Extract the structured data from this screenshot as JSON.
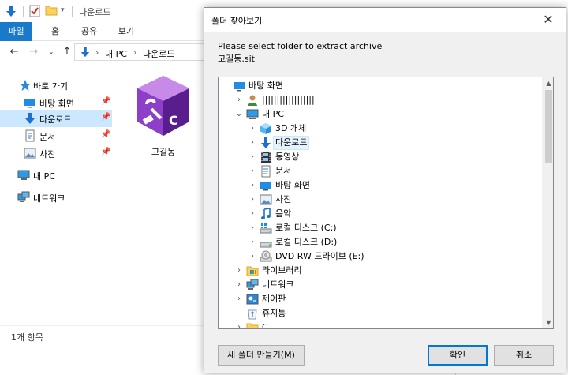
{
  "explorer": {
    "window_title": "다운로드",
    "ribbon_tabs": [
      "파일",
      "홈",
      "공유",
      "보기"
    ],
    "address": {
      "segments": [
        "내 PC",
        "다운로드"
      ],
      "separator": "›"
    },
    "nav": {
      "quick_access": "바로 가기",
      "items": [
        {
          "label": "바탕 화면",
          "icon": "desktop-icon",
          "pinned": true
        },
        {
          "label": "다운로드",
          "icon": "download-arrow-icon",
          "pinned": true,
          "selected": true
        },
        {
          "label": "문서",
          "icon": "document-icon",
          "pinned": true
        },
        {
          "label": "사진",
          "icon": "picture-icon",
          "pinned": true
        }
      ],
      "this_pc": "내 PC",
      "network": "네트워크"
    },
    "file": {
      "name": "고길동",
      "icon": "archive-box-icon"
    },
    "status": "1개 항목"
  },
  "dialog": {
    "title": "폴더 찾아보기",
    "close_glyph": "✕",
    "prompt": "Please select folder to extract archive",
    "filename": "고길동.sit",
    "tree": [
      {
        "label": "바탕 화면",
        "level": 0,
        "expander": "",
        "icon": "desktop-icon"
      },
      {
        "label": "||||||||||||||||||",
        "level": 1,
        "expander": "›",
        "icon": "user-icon"
      },
      {
        "label": "내 PC",
        "level": 1,
        "expander": "⌄",
        "icon": "computer-icon"
      },
      {
        "label": "3D 개체",
        "level": 2,
        "expander": "›",
        "icon": "cube-3d-icon"
      },
      {
        "label": "다운로드",
        "level": 2,
        "expander": "›",
        "icon": "download-arrow-icon",
        "selected": true
      },
      {
        "label": "동영상",
        "level": 2,
        "expander": "›",
        "icon": "film-icon"
      },
      {
        "label": "문서",
        "level": 2,
        "expander": "›",
        "icon": "document-icon"
      },
      {
        "label": "바탕 화면",
        "level": 2,
        "expander": "›",
        "icon": "desktop-icon"
      },
      {
        "label": "사진",
        "level": 2,
        "expander": "›",
        "icon": "picture-icon"
      },
      {
        "label": "음악",
        "level": 2,
        "expander": "›",
        "icon": "music-note-icon"
      },
      {
        "label": "로컬 디스크 (C:)",
        "level": 2,
        "expander": "›",
        "icon": "drive-windows-icon"
      },
      {
        "label": "로컬 디스크 (D:)",
        "level": 2,
        "expander": "›",
        "icon": "drive-icon"
      },
      {
        "label": "DVD RW 드라이브 (E:)",
        "level": 2,
        "expander": "›",
        "icon": "dvd-drive-icon"
      },
      {
        "label": "라이브러리",
        "level": 1,
        "expander": "›",
        "icon": "library-folder-icon"
      },
      {
        "label": "네트워크",
        "level": 1,
        "expander": "›",
        "icon": "network-icon"
      },
      {
        "label": "제어판",
        "level": 1,
        "expander": "›",
        "icon": "control-panel-icon"
      },
      {
        "label": "휴지통",
        "level": 1,
        "expander": "",
        "icon": "recycle-bin-icon"
      },
      {
        "label": "C",
        "level": 1,
        "expander": "›",
        "icon": "folder-icon"
      }
    ],
    "buttons": {
      "new_folder": "새 폴더 만들기(M)",
      "ok": "확인",
      "cancel": "취소"
    }
  },
  "colors": {
    "accent": "#1979ca",
    "selection": "#cce8ff",
    "folder": "#ffd05c"
  }
}
